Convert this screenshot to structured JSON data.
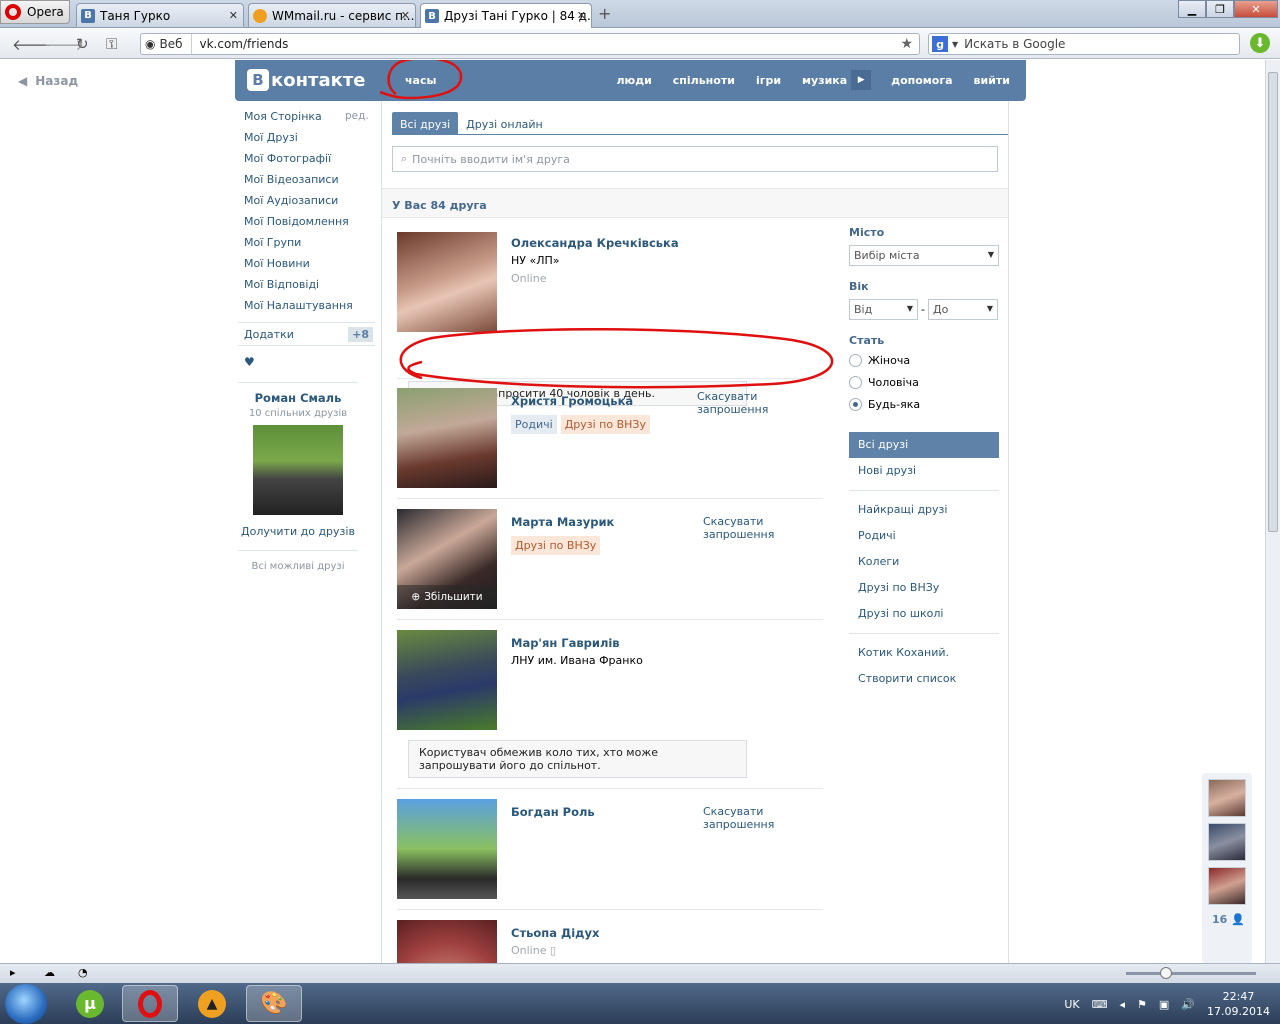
{
  "browser": {
    "menu_label": "Opera",
    "tabs": [
      {
        "label": "Таня Гурко",
        "favicon": "В"
      },
      {
        "label": "WMmail.ru - сервис п...",
        "favicon": ""
      },
      {
        "label": "Друзі Тані Гурко | 84 д...",
        "favicon": "В"
      }
    ],
    "address": {
      "badge": "Веб",
      "url": "vk.com/friends"
    },
    "search": {
      "engine": "g",
      "placeholder": "Искать в Google"
    }
  },
  "page": {
    "back_label": "Назад",
    "header": {
      "logo_text": "контакте",
      "logo_letter": "В",
      "clock_label": "часы",
      "nav": [
        "люди",
        "спільноти",
        "ігри",
        "музика",
        "допомога",
        "вийти"
      ]
    },
    "sidebar": {
      "items": [
        "Моя Сторінка",
        "Мої Друзі",
        "Мої Фотографії",
        "Мої Відеозаписи",
        "Мої Аудіозаписи",
        "Мої Повідомлення",
        "Мої Групи",
        "Мої Новини",
        "Мої Відповіді",
        "Мої Налаштування"
      ],
      "edit_label": "ред.",
      "addons_label": "Додатки",
      "addons_badge": "+8",
      "heart": "♥",
      "suggest": {
        "name": "Роман Смаль",
        "mutual": "10 спільних друзів",
        "add_label": "Долучити до друзів",
        "all_label": "Всі можливі друзі"
      }
    },
    "main": {
      "tabs": [
        "Всі друзі",
        "Друзі онлайн"
      ],
      "search_placeholder": "Почніть вводити ім'я друга",
      "count_label": "У Вас 84 друга",
      "friends": [
        {
          "name": "Олександра Кречківська",
          "sub": "НУ «ЛП»",
          "status": "Online"
        },
        {
          "name": "Христя Громоцька",
          "action": "Скасувати запрошення",
          "chips": [
            "Родичі",
            "Друзі по ВНЗу"
          ]
        },
        {
          "name": "Марта Мазурик",
          "action": "Скасувати запрошення",
          "chips": [
            "Друзі по ВНЗу"
          ],
          "zoom_label": "Збільшити"
        },
        {
          "name": "Мар'ян Гаврилів",
          "sub": "ЛНУ им. Ивана Франко"
        },
        {
          "name": "Богдан Роль",
          "action": "Скасувати запрошення"
        },
        {
          "name": "Стьопа Дідух",
          "status": "Online"
        }
      ],
      "notice_invite": "Ви можете запросити 40 чоловік в день.",
      "notice_limit": "Користувач обмежив коло тих, хто може запрошувати його до спільнот."
    },
    "filter": {
      "city_label": "Місто",
      "city_value": "Вибір міста",
      "age_label": "Вік",
      "age_from": "Від",
      "age_dash": "-",
      "age_to": "До",
      "sex_label": "Стать",
      "sex_options": [
        "Жіноча",
        "Чоловіча",
        "Будь-яка"
      ],
      "sex_selected": "Будь-яка",
      "lists_1": [
        "Всі друзі",
        "Нові друзі"
      ],
      "lists_2": [
        "Найкращі друзі",
        "Родичі",
        "Колеги",
        "Друзі по ВНЗу",
        "Друзі по школі"
      ],
      "lists_3": [
        "Котик Коханий.",
        "Створити список"
      ]
    },
    "chat": {
      "count": "16"
    }
  },
  "taskbar": {
    "lang": "UK",
    "time": "22:47",
    "date": "17.09.2014"
  },
  "colors": {
    "vk_blue": "#5a7ea6",
    "link": "#2b587a",
    "annotation_red": "#e01010"
  }
}
